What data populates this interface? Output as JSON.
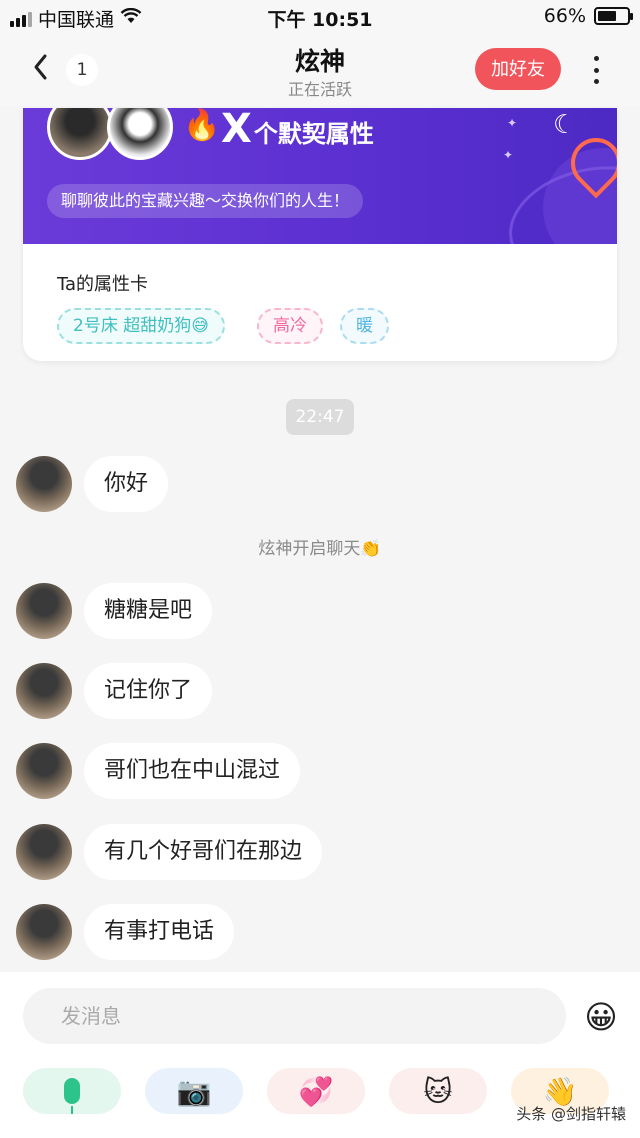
{
  "status_bar": {
    "carrier": "中国联通",
    "time": "下午 10:51",
    "battery": "66%",
    "battery_level": 0.66
  },
  "header": {
    "unread_count": "1",
    "title": "炫神",
    "subtitle": "正在活跃",
    "add_friend_label": "加好友"
  },
  "card": {
    "title_x": "X",
    "title_rest": "个默契属性",
    "banner_text": "聊聊彼此的宝藏兴趣～交换你们的人生！",
    "label": "Ta的属性卡",
    "tags": [
      "2号床 超甜奶狗😅",
      "高冷",
      "暖"
    ]
  },
  "chat": {
    "timestamp": "22:47",
    "system_note": "炫神开启聊天👏",
    "messages": [
      "你好",
      "糖糖是吧",
      "记住你了",
      "哥们也在中山混过",
      "有几个好哥们在那边",
      "有事打电话"
    ]
  },
  "input": {
    "placeholder": "发消息"
  },
  "quick_actions": [
    {
      "icon": "microphone-icon"
    },
    {
      "icon": "camera-icon",
      "glyph": "📷"
    },
    {
      "icon": "hearts-icon",
      "glyph": "💞"
    },
    {
      "icon": "cute-stickers-icon",
      "glyph": "🐱"
    },
    {
      "icon": "waving-hand-icon",
      "glyph": "👋"
    }
  ],
  "watermark": "头条 @剑指轩辕"
}
